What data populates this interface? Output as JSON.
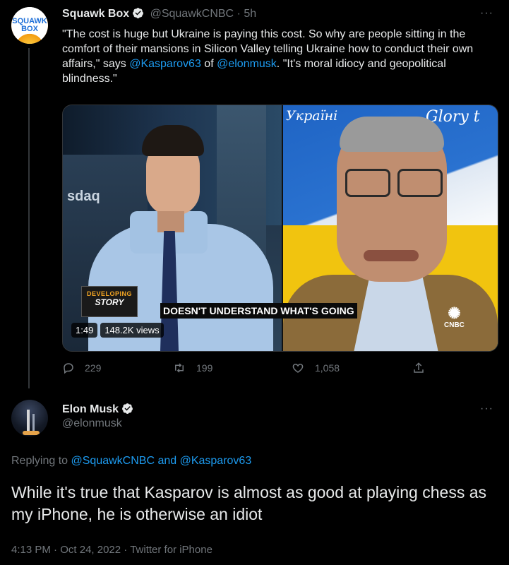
{
  "tweet1": {
    "avatar_text_line1": "SQUAWK",
    "avatar_text_line2": "BOX",
    "name": "Squawk Box",
    "handle": "@SquawkCNBC",
    "separator": "·",
    "time": "5h",
    "more": "···",
    "text_before": "\"The cost is huge but Ukraine is paying this cost. So why are people sitting in the comfort of their mansions in Silicon Valley telling Ukraine how to conduct their own affairs,\" says ",
    "mention1": "@Kasparov63",
    "text_mid": " of ",
    "mention2": "@elonmusk",
    "text_after": ". \"It's moral idiocy and geopolitical blindness.\"",
    "video": {
      "backdrop_text": "sdaq",
      "sign_text_1": "Україні",
      "sign_text_2": "Glory t",
      "badge_line1": "DEVELOPING",
      "badge_line2": "STORY",
      "caption": "DOESN'T UNDERSTAND WHAT'S GOING",
      "network": "CNBC",
      "duration": "1:49",
      "views": "148.2K views"
    },
    "actions": {
      "replies": "229",
      "retweets": "199",
      "likes": "1,058"
    }
  },
  "tweet2": {
    "name": "Elon Musk",
    "handle": "@elonmusk",
    "more": "···",
    "replying_prefix": "Replying to ",
    "replying_to_1": "@SquawkCNBC",
    "replying_and": " and ",
    "replying_to_2": "@Kasparov63",
    "text": "While it's true that Kasparov is almost as good at playing chess as my iPhone, he is otherwise an idiot",
    "time": "4:13 PM",
    "dot": " · ",
    "date": "Oct 24, 2022",
    "source": "Twitter for iPhone"
  },
  "colors": {
    "background": "#000000",
    "text": "#e7e9ea",
    "secondary": "#71767b",
    "link": "#1d9bf0",
    "verified": "#1d9bf0"
  }
}
